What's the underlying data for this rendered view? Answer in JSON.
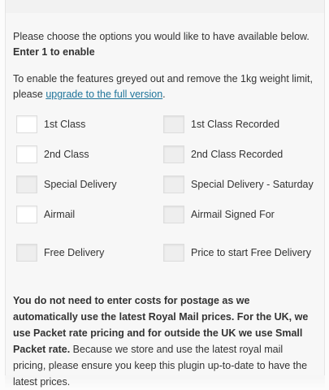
{
  "intro": {
    "line1": "Please choose the options you would like to have available below.",
    "line2": "Enter 1 to enable"
  },
  "upgrade": {
    "prefix": "To enable the features greyed out and remove the 1kg weight limit, please ",
    "link": "upgrade to the full version",
    "suffix": "."
  },
  "options": {
    "first_class": "1st Class",
    "first_class_recorded": "1st Class Recorded",
    "second_class": "2nd Class",
    "second_class_recorded": "2nd Class Recorded",
    "special_delivery": "Special Delivery",
    "special_delivery_saturday": "Special Delivery - Saturday",
    "airmail": "Airmail",
    "airmail_signed_for": "Airmail Signed For",
    "free_delivery": "Free Delivery",
    "price_free_delivery": "Price to start Free Delivery"
  },
  "footer": {
    "bold": "You do not need to enter costs for postage as we automatically use the latest Royal Mail prices. For the UK, we use Packet rate pricing and for outside the UK we use Small Packet rate.",
    "normal": " Because we store and use the latest royal mail pricing, please ensure you keep this plugin up-to-date to have the latest prices."
  }
}
